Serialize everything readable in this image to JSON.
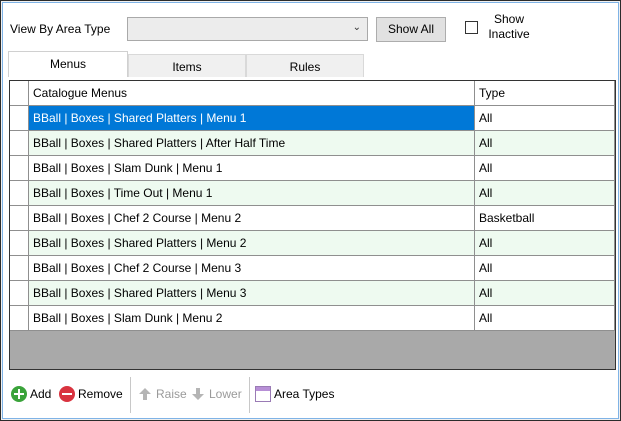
{
  "filter": {
    "label": "View By Area Type",
    "select_value": "",
    "show_all_label": "Show All",
    "show_inactive_label": "Show Inactive",
    "show_inactive_checked": false
  },
  "tabs": [
    {
      "label": "Menus",
      "active": true
    },
    {
      "label": "Items",
      "active": false
    },
    {
      "label": "Rules",
      "active": false
    }
  ],
  "grid": {
    "columns": [
      "Catalogue Menus",
      "Type"
    ],
    "rows": [
      {
        "name": "BBall | Boxes | Shared Platters | Menu 1",
        "type": "All",
        "selected": true
      },
      {
        "name": "BBall | Boxes | Shared Platters | After Half Time",
        "type": "All"
      },
      {
        "name": "BBall | Boxes | Slam Dunk | Menu 1",
        "type": "All"
      },
      {
        "name": "BBall | Boxes | Time Out | Menu 1",
        "type": "All"
      },
      {
        "name": "BBall | Boxes | Chef 2 Course | Menu 2",
        "type": "Basketball"
      },
      {
        "name": "BBall | Boxes | Shared Platters | Menu 2",
        "type": "All"
      },
      {
        "name": "BBall | Boxes | Chef 2 Course | Menu 3",
        "type": "All"
      },
      {
        "name": "BBall | Boxes | Shared Platters | Menu 3",
        "type": "All"
      },
      {
        "name": "BBall | Boxes | Slam Dunk | Menu 2",
        "type": "All"
      }
    ]
  },
  "toolbar": {
    "add_label": "Add",
    "remove_label": "Remove",
    "raise_label": "Raise",
    "lower_label": "Lower",
    "area_types_label": "Area Types"
  },
  "colors": {
    "selection": "#0078d7",
    "alt_row": "#eefaf0",
    "grid_empty": "#a9a9a9"
  }
}
